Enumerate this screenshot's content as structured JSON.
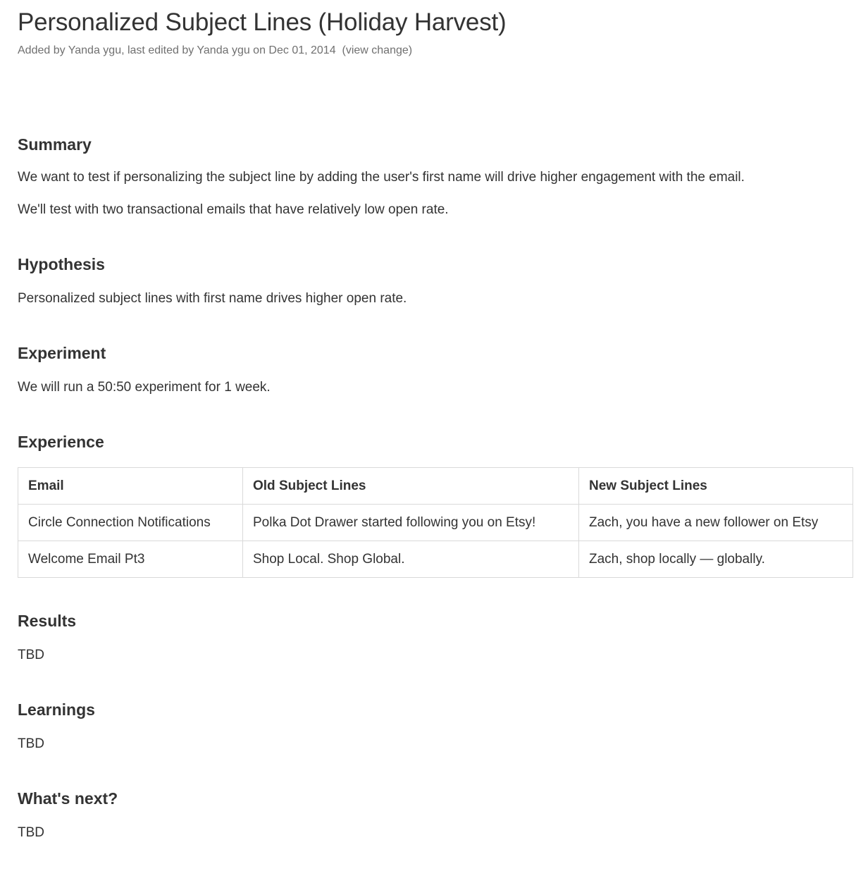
{
  "page": {
    "title": "Personalized Subject Lines (Holiday Harvest)",
    "meta_text": "Added by Yanda ygu, last edited by Yanda ygu on Dec 01, 2014",
    "meta_link": "(view change)"
  },
  "summary": {
    "heading": "Summary",
    "line1": "We want to test if personalizing the subject line by adding the user's first name will drive higher engagement with the email.",
    "line2": "We'll test with two transactional emails that have relatively low open rate."
  },
  "hypothesis": {
    "heading": "Hypothesis",
    "text": "Personalized subject lines with first name drives higher open rate."
  },
  "experiment": {
    "heading": "Experiment",
    "text": "We will run a 50:50 experiment for 1 week."
  },
  "experience": {
    "heading": "Experience",
    "columns": [
      "Email",
      "Old Subject Lines",
      "New Subject Lines"
    ],
    "rows": [
      [
        "Circle Connection Notifications",
        "Polka Dot Drawer started following you on Etsy!",
        "Zach, you have a new follower on Etsy"
      ],
      [
        "Welcome Email Pt3",
        "Shop Local. Shop Global.",
        "Zach, shop locally — globally."
      ]
    ]
  },
  "results": {
    "heading": "Results",
    "text": "TBD"
  },
  "learnings": {
    "heading": "Learnings",
    "text": "TBD"
  },
  "next": {
    "heading": "What's next?",
    "text": "TBD"
  }
}
